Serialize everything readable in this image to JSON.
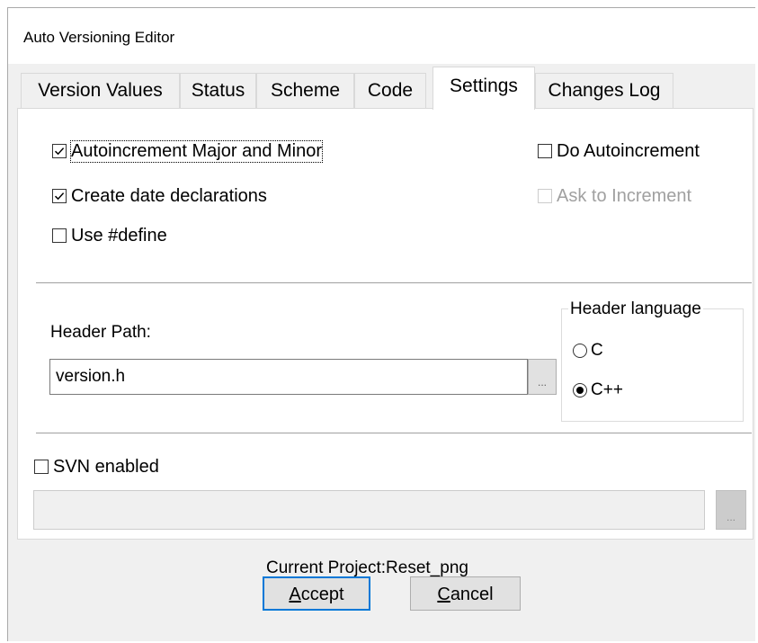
{
  "window": {
    "title": "Auto Versioning Editor"
  },
  "tabs": [
    {
      "label": "Version Values",
      "active": false
    },
    {
      "label": "Status",
      "active": false
    },
    {
      "label": "Scheme",
      "active": false
    },
    {
      "label": "Code",
      "active": false
    },
    {
      "label": "Settings",
      "active": true
    },
    {
      "label": "Changes Log",
      "active": false
    }
  ],
  "settings": {
    "autoincrement_major_minor": {
      "label": "Autoincrement Major and Minor",
      "checked": true
    },
    "create_date_declarations": {
      "label": "Create date declarations",
      "checked": true
    },
    "use_define": {
      "label": "Use #define",
      "checked": false
    },
    "do_autoincrement": {
      "label": "Do Autoincrement",
      "checked": false
    },
    "ask_to_increment": {
      "label": "Ask to Increment",
      "checked": false,
      "disabled": true
    }
  },
  "header": {
    "path_label": "Header Path:",
    "path_value": "version.h",
    "browse_label": "...",
    "language_group": "Header language",
    "languages": [
      {
        "label": "C",
        "selected": false
      },
      {
        "label": "C++",
        "selected": true
      }
    ]
  },
  "svn": {
    "label": "SVN enabled",
    "checked": false,
    "path_value": "",
    "browse_label": "..."
  },
  "footer": {
    "current_project": "Current Project:Reset_png",
    "accept_accel": "A",
    "accept_rest": "ccept",
    "cancel_accel": "C",
    "cancel_rest": "ancel"
  }
}
